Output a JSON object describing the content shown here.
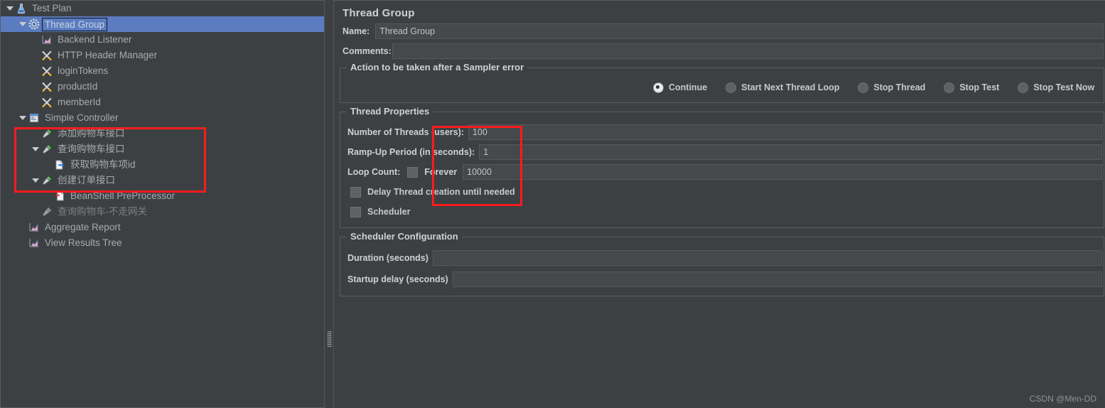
{
  "tree": {
    "items": [
      {
        "label": "Test Plan",
        "icon": "test-plan-icon",
        "depth": 0,
        "toggle": "open",
        "selected": false,
        "dim": false
      },
      {
        "label": "Thread Group",
        "icon": "thread-group-icon",
        "depth": 1,
        "toggle": "open",
        "selected": true,
        "dim": false
      },
      {
        "label": "Backend Listener",
        "icon": "listener-icon",
        "depth": 2,
        "toggle": "none",
        "selected": false,
        "dim": false
      },
      {
        "label": "HTTP Header Manager",
        "icon": "config-element-icon",
        "depth": 2,
        "toggle": "none",
        "selected": false,
        "dim": false
      },
      {
        "label": "loginTokens",
        "icon": "config-element-icon",
        "depth": 2,
        "toggle": "none",
        "selected": false,
        "dim": false
      },
      {
        "label": "productId",
        "icon": "config-element-icon",
        "depth": 2,
        "toggle": "none",
        "selected": false,
        "dim": false
      },
      {
        "label": "memberId",
        "icon": "config-element-icon",
        "depth": 2,
        "toggle": "none",
        "selected": false,
        "dim": false
      },
      {
        "label": "Simple Controller",
        "icon": "controller-icon",
        "depth": 1,
        "toggle": "open",
        "selected": false,
        "dim": false
      },
      {
        "label": "添加购物车接口",
        "icon": "sampler-icon",
        "depth": 2,
        "toggle": "none",
        "selected": false,
        "dim": false
      },
      {
        "label": "查询购物车接口",
        "icon": "sampler-icon",
        "depth": 2,
        "toggle": "open",
        "selected": false,
        "dim": false
      },
      {
        "label": "获取购物车项id",
        "icon": "post-processor-icon",
        "depth": 3,
        "toggle": "none",
        "selected": false,
        "dim": false
      },
      {
        "label": "创建订单接口",
        "icon": "sampler-icon",
        "depth": 2,
        "toggle": "open",
        "selected": false,
        "dim": false
      },
      {
        "label": "BeanShell PreProcessor",
        "icon": "pre-processor-icon",
        "depth": 3,
        "toggle": "none",
        "selected": false,
        "dim": false
      },
      {
        "label": "查询购物车-不走网关",
        "icon": "sampler-disabled-icon",
        "depth": 2,
        "toggle": "none",
        "selected": false,
        "dim": true
      },
      {
        "label": "Aggregate Report",
        "icon": "listener-icon",
        "depth": 1,
        "toggle": "none",
        "selected": false,
        "dim": false
      },
      {
        "label": "View Results Tree",
        "icon": "listener-icon",
        "depth": 1,
        "toggle": "none",
        "selected": false,
        "dim": false
      }
    ]
  },
  "panel": {
    "title": "Thread Group",
    "name_label": "Name:",
    "name_value": "Thread Group",
    "comments_label": "Comments:",
    "comments_value": ""
  },
  "sampler_error": {
    "group_title": "Action to be taken after a Sampler error",
    "options": [
      {
        "label": "Continue",
        "selected": true
      },
      {
        "label": "Start Next Thread Loop",
        "selected": false
      },
      {
        "label": "Stop Thread",
        "selected": false
      },
      {
        "label": "Stop Test",
        "selected": false
      },
      {
        "label": "Stop Test Now",
        "selected": false
      }
    ]
  },
  "thread_properties": {
    "group_title": "Thread Properties",
    "num_threads_label": "Number of Threads (users):",
    "num_threads_value": "100",
    "ramp_up_label": "Ramp-Up Period (in seconds):",
    "ramp_up_value": "1",
    "loop_count_label": "Loop Count:",
    "forever_label": "Forever",
    "forever_checked": false,
    "loop_count_value": "10000",
    "delay_thread_label": "Delay Thread creation until needed",
    "delay_thread_checked": false,
    "scheduler_label": "Scheduler",
    "scheduler_checked": false
  },
  "scheduler_config": {
    "group_title": "Scheduler Configuration",
    "duration_label": "Duration (seconds)",
    "duration_value": "",
    "startup_delay_label": "Startup delay (seconds)",
    "startup_delay_value": ""
  },
  "watermark": "CSDN @Men-DD",
  "colors": {
    "panel_bg": "#3c4043",
    "selection_blue": "#5b7cc0",
    "annotation_red": "#fb1c1c",
    "field_bg": "#45494c",
    "text": "#b9bcbf"
  }
}
